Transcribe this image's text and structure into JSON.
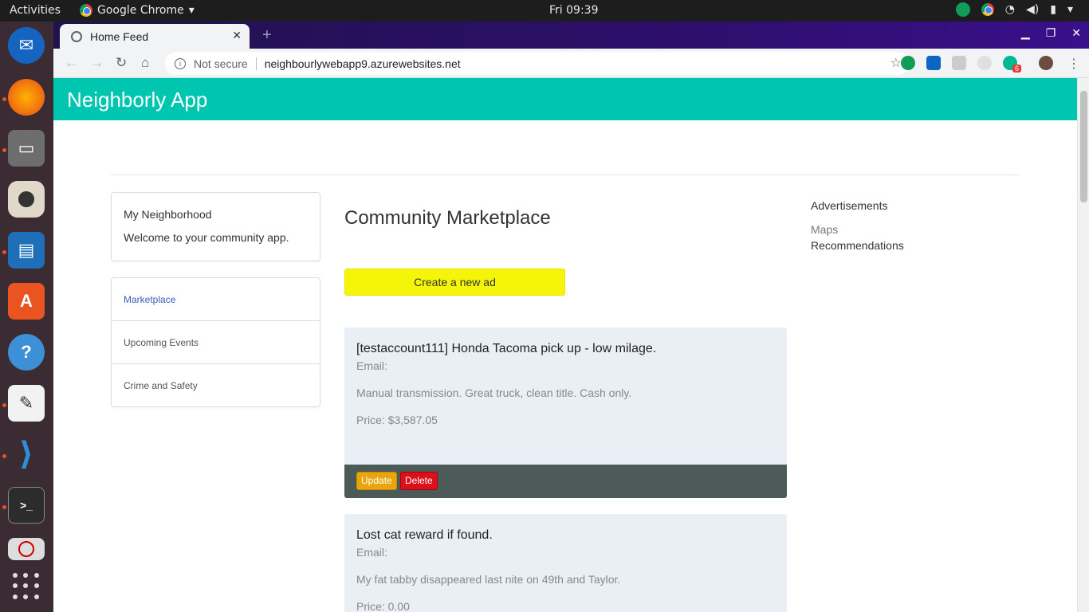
{
  "system": {
    "activities": "Activities",
    "app_name": "Google Chrome",
    "clock": "Fri 09:39"
  },
  "browser": {
    "tab_title": "Home Feed",
    "security_label": "Not secure",
    "url": "neighbourlywebapp9.azurewebsites.net",
    "extension_badge": "6"
  },
  "app": {
    "brand": "Neighborly App"
  },
  "sidebar": {
    "intro_title": "My Neighborhood",
    "intro_text": "Welcome to your community app.",
    "menu": [
      {
        "label": "Marketplace",
        "active": true
      },
      {
        "label": "Upcoming Events",
        "active": false
      },
      {
        "label": "Crime and Safety",
        "active": false
      }
    ]
  },
  "main": {
    "heading": "Community Marketplace",
    "create_label": "Create a new ad",
    "ads": [
      {
        "title": "[testaccount111] Honda Tacoma pick up - low milage.",
        "email_label": "Email:",
        "description": "Manual transmission. Great truck, clean title. Cash only.",
        "price": "Price: $3,587.05",
        "update_label": "Update",
        "delete_label": "Delete"
      },
      {
        "title": "Lost cat reward if found.",
        "email_label": "Email:",
        "description": "My fat tabby disappeared last nite on 49th and Taylor.",
        "price": "Price: 0.00"
      }
    ]
  },
  "right": {
    "heading": "Advertisements",
    "maps": "Maps",
    "recommendations": "Recommendations"
  },
  "colors": {
    "appbar": "#00c5af",
    "create_button": "#f5f50a",
    "ad_card": "#e9eff5",
    "ad_footer": "#4d5b58",
    "update_button": "#e8a50e",
    "delete_button": "#d9111c",
    "active_link": "#3b5bb5"
  }
}
